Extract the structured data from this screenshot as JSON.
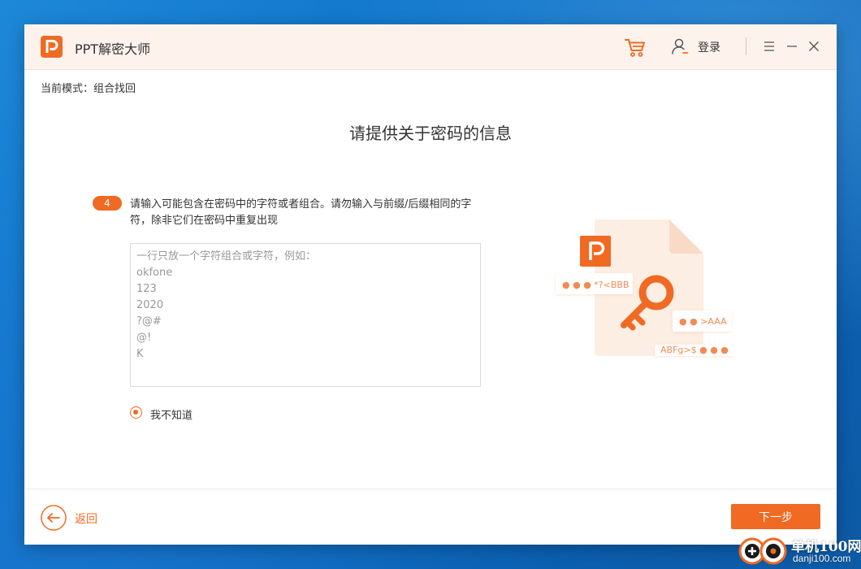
{
  "app": {
    "title": "PPT解密大师",
    "logo_letter": "P",
    "accent_color": "#f06a23",
    "titlebar_bg": "#fdf3ec"
  },
  "titlebar": {
    "cart_icon": "cart-icon",
    "user_icon": "user-icon",
    "login_label": "登录",
    "menu_icon": "hamburger-menu-icon",
    "minimize_icon": "minimize-icon",
    "close_icon": "close-icon"
  },
  "mode": {
    "label": "当前模式：",
    "value": "组合找回"
  },
  "main": {
    "title": "请提供关于密码的信息",
    "step": {
      "number": "4",
      "text": "请输入可能包含在密码中的字符或者组合。请勿输入与前缀/后缀相同的字符，除非它们在密码中重复出现"
    },
    "chars_input": {
      "value": "",
      "placeholder": "一行只放一个字符组合或字符，例如：\nokfone\n123\n2020\n?@#\n@!\nK"
    },
    "dont_know_option": {
      "label": "我不知道",
      "checked": true
    },
    "illustration": {
      "doc_logo_letter": "P",
      "tags": [
        "● ● ●  *?<BBB",
        "● ●  >AAA",
        "ABFg>$ ● ● ●"
      ]
    }
  },
  "footer": {
    "back_label": "返回",
    "next_label": "下一步"
  },
  "watermark": {
    "title": "单机100网",
    "url": "danji100.com"
  }
}
